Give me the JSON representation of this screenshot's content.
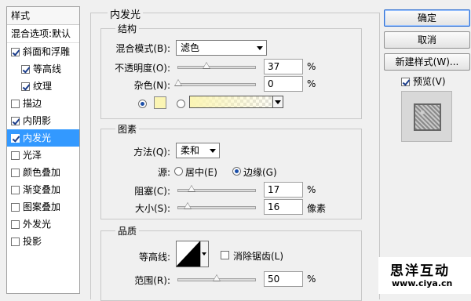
{
  "styles_panel": {
    "header": "样式",
    "blend_options": "混合选项:默认",
    "items": [
      {
        "label": "斜面和浮雕",
        "checked": true
      },
      {
        "label": "等高线",
        "checked": true
      },
      {
        "label": "纹理",
        "checked": true
      },
      {
        "label": "描边",
        "checked": false
      },
      {
        "label": "内阴影",
        "checked": true
      },
      {
        "label": "内发光",
        "checked": true
      },
      {
        "label": "光泽",
        "checked": false
      },
      {
        "label": "颜色叠加",
        "checked": false
      },
      {
        "label": "渐变叠加",
        "checked": false
      },
      {
        "label": "图案叠加",
        "checked": false
      },
      {
        "label": "外发光",
        "checked": false
      },
      {
        "label": "投影",
        "checked": false
      }
    ]
  },
  "inner_glow": {
    "title": "内发光",
    "structure": {
      "title": "结构",
      "blend_mode_label": "混合模式(B):",
      "blend_mode_value": "滤色",
      "opacity_label": "不透明度(O):",
      "opacity_value": "37",
      "opacity_unit": "%",
      "opacity_percent": 37,
      "noise_label": "杂色(N):",
      "noise_value": "0",
      "noise_unit": "%",
      "noise_percent": 0,
      "solid_color": "#fbf5b4"
    },
    "elements": {
      "title": "图素",
      "method_label": "方法(Q):",
      "method_value": "柔和",
      "source_label": "源:",
      "source_center": "居中(E)",
      "source_edge": "边缘(G)",
      "choke_label": "阻塞(C):",
      "choke_value": "17",
      "choke_unit": "%",
      "choke_percent": 17,
      "size_label": "大小(S):",
      "size_value": "16",
      "size_unit": "像素"
    },
    "quality": {
      "title": "品质",
      "contour_label": "等高线:",
      "antialias_label": "消除锯齿(L)",
      "range_label": "范围(R):",
      "range_value": "50",
      "range_unit": "%",
      "range_percent": 50
    }
  },
  "buttons": {
    "ok": "确定",
    "cancel": "取消",
    "new_style": "新建样式(W)...",
    "preview": "预览(V)"
  },
  "watermark": {
    "name": "思洋互动",
    "url": "www.ciya.cn"
  },
  "colors": {
    "selection": "#3399ff",
    "glow": "#fbf5b4"
  }
}
